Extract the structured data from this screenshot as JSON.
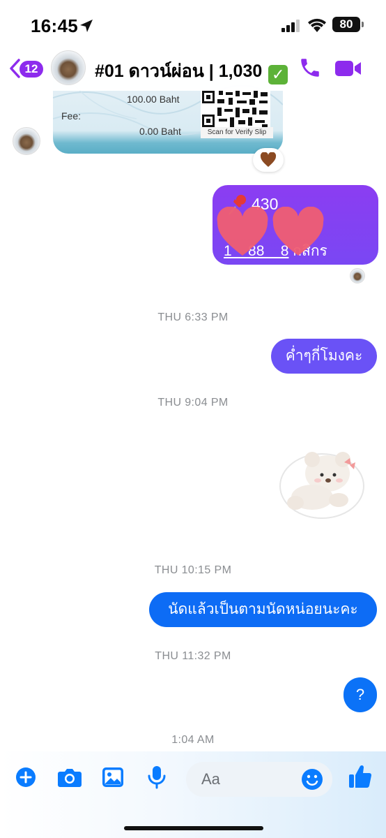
{
  "status_bar": {
    "time": "16:45",
    "battery": "80"
  },
  "header": {
    "back_count": "12",
    "title": "#01 ดาวน์ผ่อน | 1,030",
    "accent_color": "#8d2bed"
  },
  "slip": {
    "amount": "100.00 Baht",
    "fee_label": "Fee:",
    "fee_value": "0.00 Baht",
    "qr_caption": "Scan for Verify Slip",
    "reaction": "brown-heart"
  },
  "messages": {
    "pinned_amount": "430",
    "pinned_account_number": "1__88__8",
    "pinned_bank": "กสิกร",
    "ts1": "THU 6:33 PM",
    "msg1": "ค่ำๆกี่โมงคะ",
    "ts2": "THU 9:04 PM",
    "ts3": "THU 10:15 PM",
    "msg2": "นัดแล้วเป็นตามนัดหน่อยนะคะ",
    "ts4": "THU 11:32 PM",
    "msg3": "?",
    "ts5": "1:04 AM"
  },
  "composer": {
    "placeholder": "Aa",
    "icons": [
      "plus-icon",
      "camera-icon",
      "image-icon",
      "microphone-icon",
      "emoji-icon",
      "thumbs-up-icon"
    ],
    "accent_color": "#0a7cff"
  }
}
